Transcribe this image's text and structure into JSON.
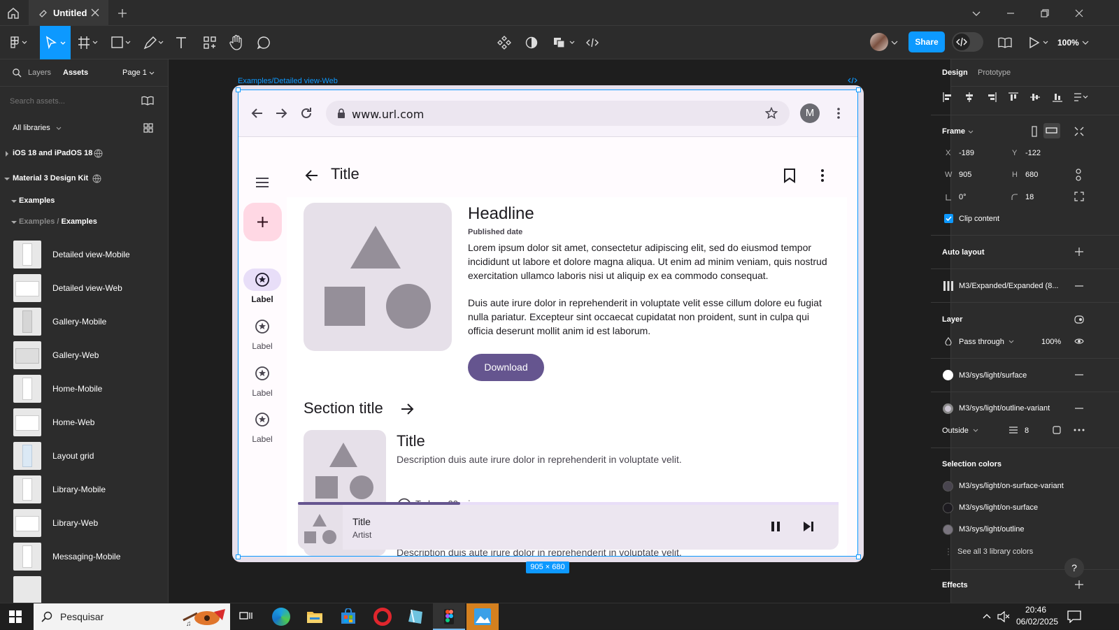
{
  "window": {
    "tab_title": "Untitled"
  },
  "toolbar": {
    "share_label": "Share",
    "zoom": "100%"
  },
  "left_panel": {
    "tabs": [
      "Layers",
      "Assets"
    ],
    "page": "Page 1",
    "search_placeholder": "Search assets...",
    "all_libraries": "All libraries",
    "libraries": [
      "iOS 18 and iPadOS 18",
      "Material 3 Design Kit"
    ],
    "examples_group": "Examples",
    "breadcrumb_parent": "Examples",
    "breadcrumb_sep": " / ",
    "breadcrumb_current": "Examples",
    "assets": [
      "Detailed view-Mobile",
      "Detailed view-Web",
      "Gallery-Mobile",
      "Gallery-Web",
      "Home-Mobile",
      "Home-Web",
      "Layout grid",
      "Library-Mobile",
      "Library-Web",
      "Messaging-Mobile"
    ]
  },
  "canvas": {
    "frame_label": "Examples/Detailed view-Web",
    "size_badge": "905 × 680"
  },
  "frame": {
    "url": "www.url.com",
    "avatar_letter": "M",
    "app_title": "Title",
    "nav_labels": [
      "Label",
      "Label",
      "Label",
      "Label"
    ],
    "headline": "Headline",
    "published": "Published date",
    "paragraph1": "Lorem ipsum dolor sit amet, consectetur adipiscing elit, sed do eiusmod tempor incididunt ut labore et dolore magna aliqua. Ut enim ad minim veniam, quis nostrud exercitation ullamco laboris nisi ut aliquip ex ea commodo consequat.",
    "paragraph2": "Duis aute irure dolor in reprehenderit in voluptate velit esse cillum dolore eu fugiat nulla pariatur. Excepteur sint occaecat cupidatat non proident, sunt in culpa qui officia deserunt mollit anim id est laborum.",
    "download_label": "Download",
    "section_title": "Section title",
    "card_title": "Title",
    "card_desc": "Description duis aute irure dolor in reprehenderit in voluptate velit.",
    "card_meta": "Today • 23 min",
    "card2_desc": "Description duis aute irure dolor in reprehenderit in voluptate velit.",
    "player_title": "Title",
    "player_artist": "Artist",
    "player_progress": 0.3
  },
  "right_panel": {
    "tabs": [
      "Design",
      "Prototype"
    ],
    "frame_section": "Frame",
    "x_label": "X",
    "x_value": "-189",
    "y_label": "Y",
    "y_value": "-122",
    "w_label": "W",
    "w_value": "905",
    "h_label": "H",
    "h_value": "680",
    "rotation": "0°",
    "radius": "18",
    "clip_content": "Clip content",
    "auto_layout": "Auto layout",
    "layout_grid_name": "M3/Expanded/Expanded (8...",
    "layer_section": "Layer",
    "blend_mode": "Pass through",
    "opacity": "100%",
    "fill_style": "M3/sys/light/surface",
    "stroke_style": "M3/sys/light/outline-variant",
    "stroke_position": "Outside",
    "stroke_weight": "8",
    "selection_colors": "Selection colors",
    "colors": [
      {
        "name": "M3/sys/light/on-surface-variant",
        "hex": "#49454f"
      },
      {
        "name": "M3/sys/light/on-surface",
        "hex": "#1d1b20"
      },
      {
        "name": "M3/sys/light/outline",
        "hex": "#79747e"
      }
    ],
    "see_all": "See all 3 library colors",
    "effects": "Effects",
    "help": "?"
  },
  "taskbar": {
    "search_placeholder": "Pesquisar",
    "time": "20:46",
    "date": "06/02/2025"
  },
  "colors": {
    "accent": "#0d99ff",
    "primary": "#65558f",
    "surface": "#fffbfe",
    "fab": "#ffd8e4"
  }
}
